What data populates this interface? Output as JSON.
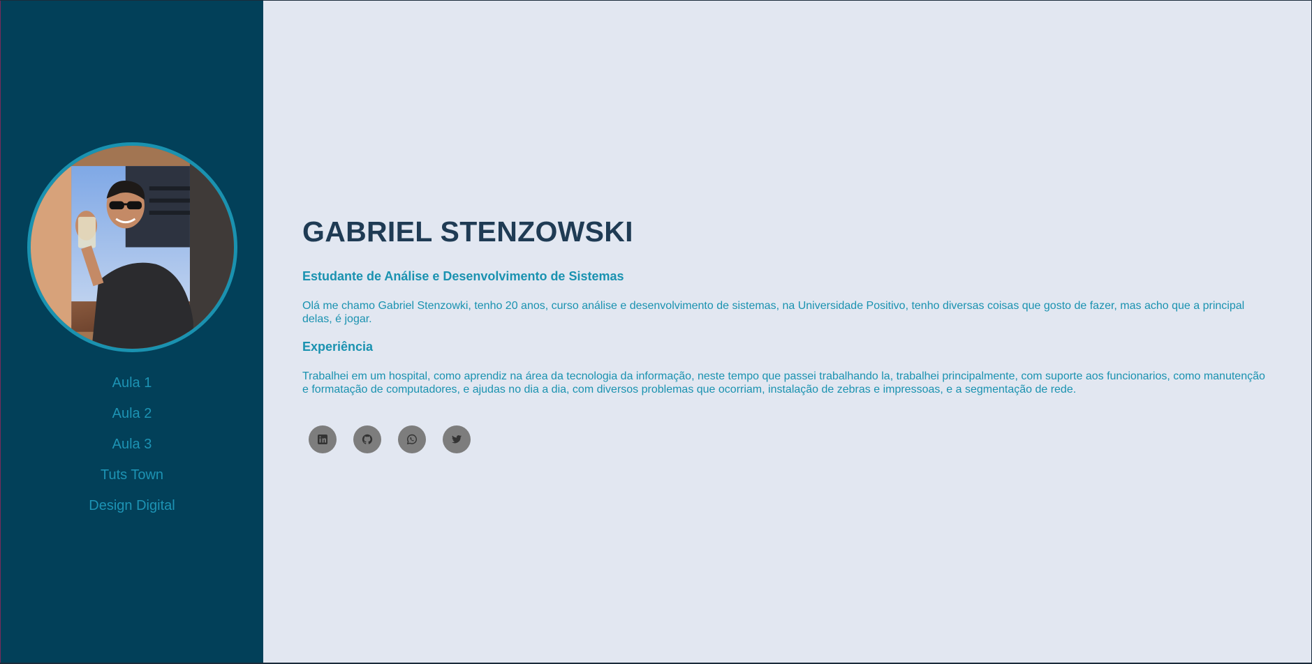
{
  "profile": {
    "name": "GABRIEL STENZOWSKI",
    "subtitle": "Estudante de Análise e Desenvolvimento de Sistemas",
    "about": "Olá me chamo Gabriel Stenzowki, tenho 20 anos, curso análise e desenvolvimento de sistemas, na Universidade Positivo, tenho diversas coisas que gosto de fazer, mas acho que a principal delas, é jogar.",
    "experience_title": "Experiência",
    "experience": "Trabalhei em um hospital, como aprendiz na área da tecnologia da informação, neste tempo que passei trabalhando la, trabalhei principalmente, com suporte aos funcionarios, como manutenção e formatação de computadores, e ajudas no dia a dia, com diversos problemas que ocorriam, instalação de zebras e impressoas, e a segmentação de rede."
  },
  "sidebar": {
    "items": [
      {
        "label": "Aula 1"
      },
      {
        "label": "Aula 2"
      },
      {
        "label": "Aula 3"
      },
      {
        "label": "Tuts Town"
      },
      {
        "label": "Design Digital"
      }
    ]
  },
  "socials": [
    {
      "icon": "linkedin-icon"
    },
    {
      "icon": "github-icon"
    },
    {
      "icon": "whatsapp-icon"
    },
    {
      "icon": "twitter-icon"
    }
  ],
  "colors": {
    "sidebar_bg": "#024059",
    "main_bg": "#e2e7f1",
    "accent": "#1a92b0",
    "heading": "#1f3b54",
    "social_bg": "#7d7d7d"
  }
}
